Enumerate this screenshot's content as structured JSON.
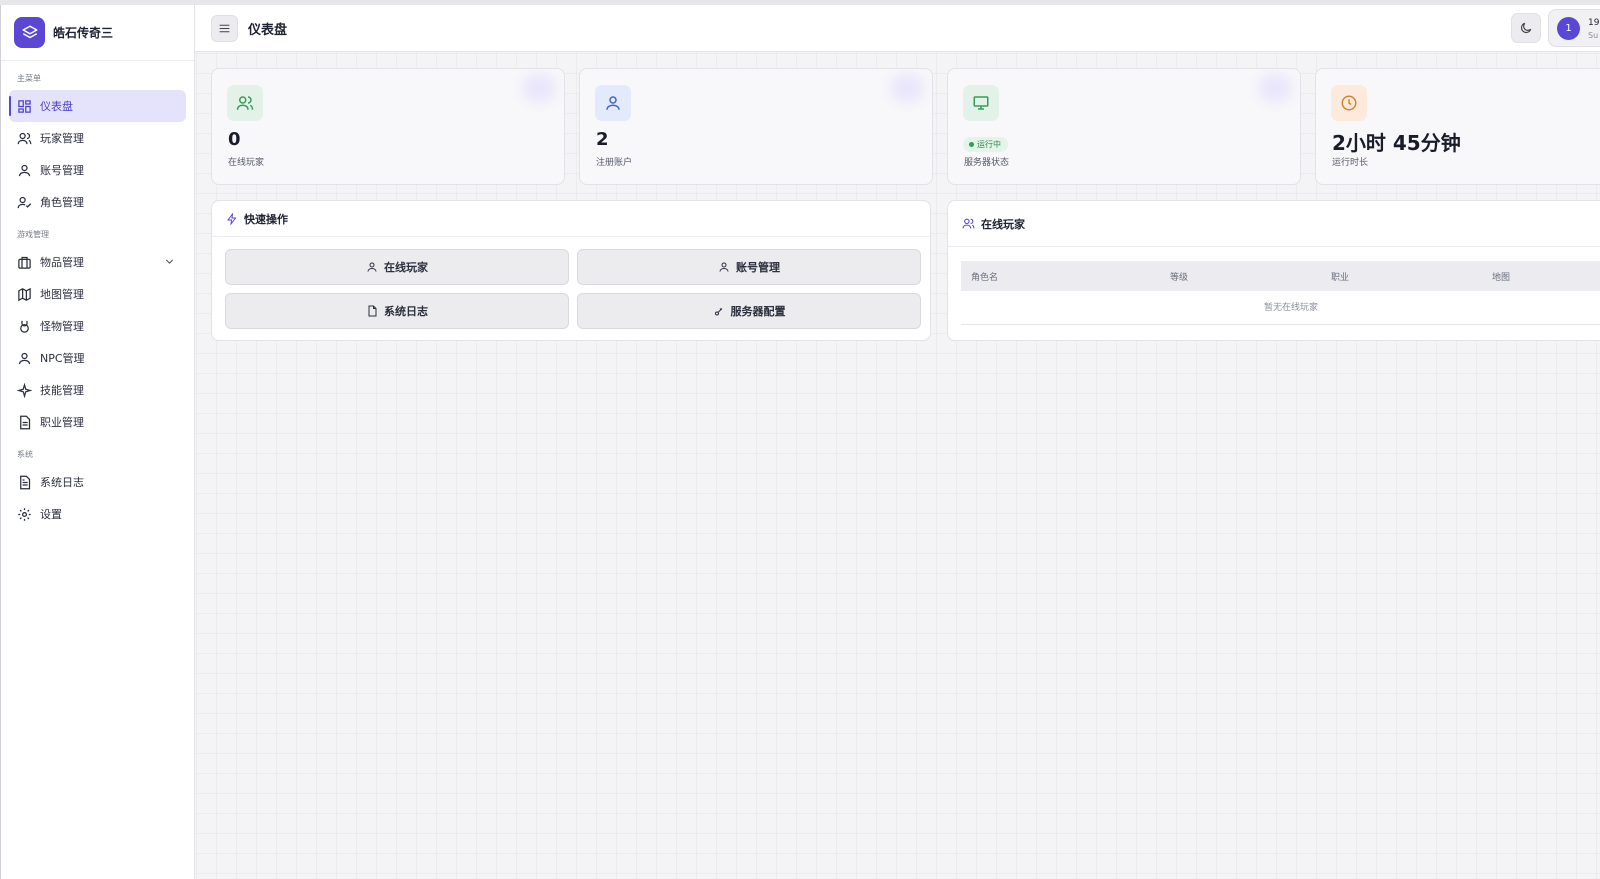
{
  "app": {
    "name": "皓石传奇三"
  },
  "sidebar": {
    "sections": [
      {
        "label": "主菜单"
      },
      {
        "label": "游戏管理"
      },
      {
        "label": "系统"
      }
    ],
    "items": [
      {
        "label": "仪表盘",
        "icon": "dashboard-grid-icon"
      },
      {
        "label": "玩家管理",
        "icon": "users-icon"
      },
      {
        "label": "账号管理",
        "icon": "user-icon"
      },
      {
        "label": "角色管理",
        "icon": "user-check-icon"
      },
      {
        "label": "物品管理",
        "icon": "briefcase-icon"
      },
      {
        "label": "地图管理",
        "icon": "map-icon"
      },
      {
        "label": "怪物管理",
        "icon": "monster-icon"
      },
      {
        "label": "NPC管理",
        "icon": "npc-user-icon"
      },
      {
        "label": "技能管理",
        "icon": "sparkle-icon"
      },
      {
        "label": "职业管理",
        "icon": "file-icon"
      },
      {
        "label": "系统日志",
        "icon": "file-text-icon"
      },
      {
        "label": "设置",
        "icon": "gear-icon"
      }
    ]
  },
  "header": {
    "title": "仪表盘",
    "user": {
      "avatar": "1",
      "id": "19",
      "role": "Su"
    }
  },
  "stats": [
    {
      "value": "0",
      "label": "在线玩家"
    },
    {
      "value": "2",
      "label": "注册账户"
    },
    {
      "status": "运行中",
      "label": "服务器状态"
    },
    {
      "value": "2小时 45分钟",
      "label": "运行时长"
    }
  ],
  "quick_actions": {
    "title": "快速操作",
    "buttons": [
      "在线玩家",
      "账号管理",
      "系统日志",
      "服务器配置"
    ]
  },
  "online_players": {
    "title": "在线玩家",
    "columns": [
      "角色名",
      "等级",
      "职业",
      "地图"
    ],
    "empty": "暂无在线玩家"
  },
  "colors": {
    "accent": "#5b47d6",
    "active_bg": "#e5e3fb",
    "status_green": "#2f8a4d",
    "orange": "#d9822b"
  }
}
